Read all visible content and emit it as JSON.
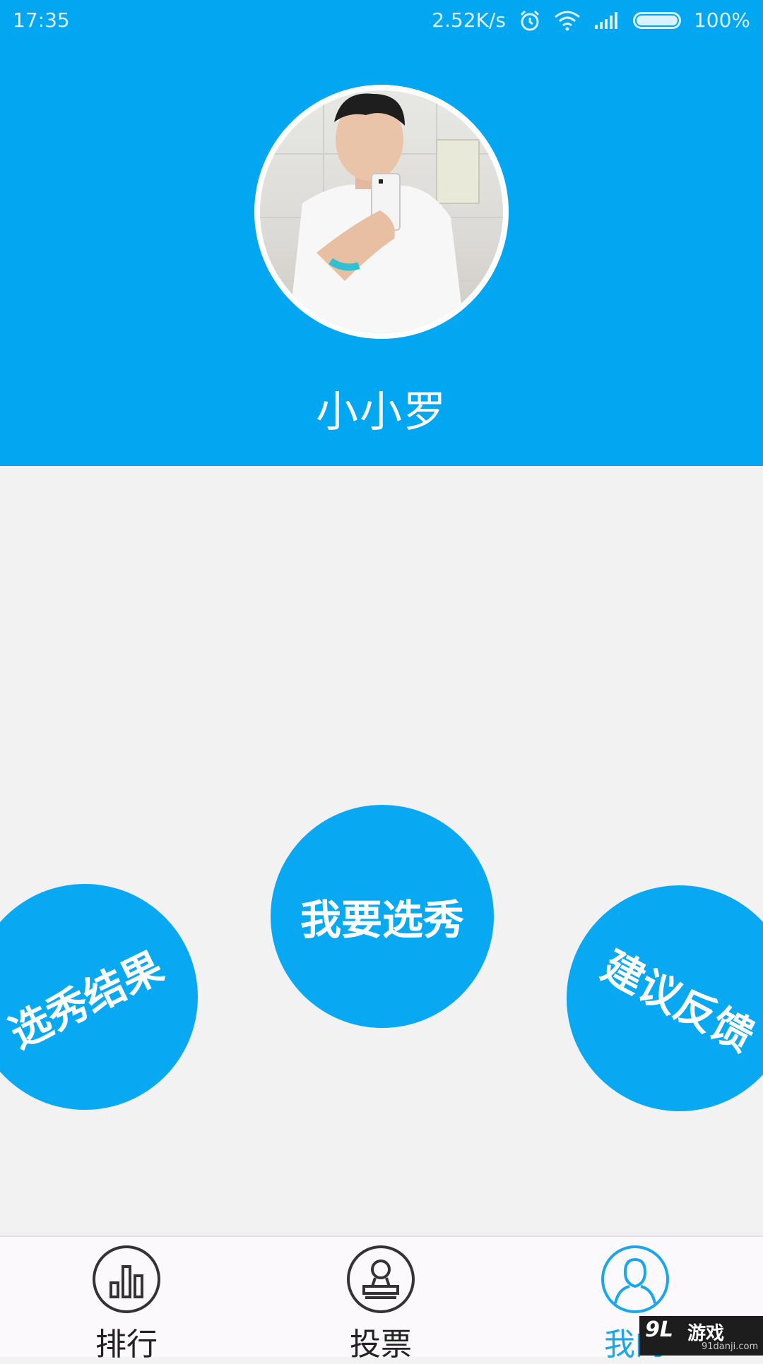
{
  "status_bar": {
    "time": "17:35",
    "speed": "2.52K/s",
    "battery": "100%",
    "icons": [
      "alarm-icon",
      "wifi-icon",
      "signal-icon",
      "battery-icon"
    ]
  },
  "profile": {
    "username": "小小罗",
    "avatar": "profile-photo"
  },
  "actions": {
    "left": "选秀结果",
    "center": "我要选秀",
    "right": "建议反馈"
  },
  "nav": {
    "items": [
      {
        "label": "排行",
        "icon": "bar-chart-icon",
        "active": false
      },
      {
        "label": "投票",
        "icon": "stamp-icon",
        "active": false
      },
      {
        "label": "我的",
        "icon": "person-icon",
        "active": true
      }
    ]
  },
  "watermark": {
    "logo": "9L",
    "name": "游戏",
    "domain": "91danji.com"
  },
  "colors": {
    "primary": "#03a6f0",
    "background": "#f2f2f2",
    "active_tab": "#19a6ec"
  }
}
